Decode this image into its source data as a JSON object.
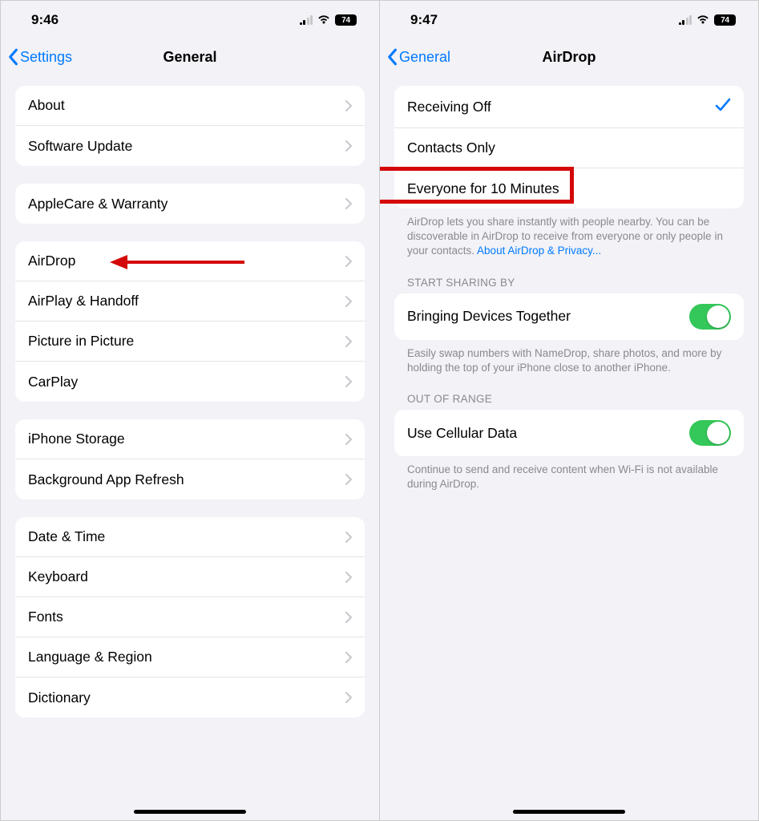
{
  "left": {
    "status": {
      "time": "9:46",
      "battery": "74"
    },
    "nav": {
      "back": "Settings",
      "title": "General"
    },
    "groups": [
      {
        "rows": [
          {
            "label": "About"
          },
          {
            "label": "Software Update"
          }
        ]
      },
      {
        "rows": [
          {
            "label": "AppleCare & Warranty"
          }
        ]
      },
      {
        "rows": [
          {
            "label": "AirDrop"
          },
          {
            "label": "AirPlay & Handoff"
          },
          {
            "label": "Picture in Picture"
          },
          {
            "label": "CarPlay"
          }
        ]
      },
      {
        "rows": [
          {
            "label": "iPhone Storage"
          },
          {
            "label": "Background App Refresh"
          }
        ]
      },
      {
        "rows": [
          {
            "label": "Date & Time"
          },
          {
            "label": "Keyboard"
          },
          {
            "label": "Fonts"
          },
          {
            "label": "Language & Region"
          },
          {
            "label": "Dictionary"
          }
        ]
      }
    ]
  },
  "right": {
    "status": {
      "time": "9:47",
      "battery": "74"
    },
    "nav": {
      "back": "General",
      "title": "AirDrop"
    },
    "receiving": {
      "options": [
        {
          "label": "Receiving Off",
          "selected": true
        },
        {
          "label": "Contacts Only",
          "selected": false
        },
        {
          "label": "Everyone for 10 Minutes",
          "selected": false
        }
      ],
      "footnote_text": "AirDrop lets you share instantly with people nearby. You can be discoverable in AirDrop to receive from everyone or only people in your contacts. ",
      "footnote_link": "About AirDrop & Privacy..."
    },
    "sharing": {
      "header": "START SHARING BY",
      "row_label": "Bringing Devices Together",
      "toggle_on": true,
      "footnote": "Easily swap numbers with NameDrop, share photos, and more by holding the top of your iPhone close to another iPhone."
    },
    "range": {
      "header": "OUT OF RANGE",
      "row_label": "Use Cellular Data",
      "toggle_on": true,
      "footnote": "Continue to send and receive content when Wi-Fi is not available during AirDrop."
    }
  }
}
